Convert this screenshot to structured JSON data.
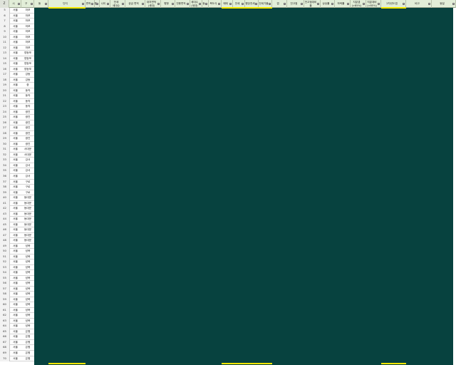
{
  "columns": [
    {
      "label": "Z",
      "filter": false
    },
    {
      "label": "시",
      "filter": true
    },
    {
      "label": "구",
      "filter": true
    },
    {
      "label": "동",
      "filter": true
    },
    {
      "label": "단지",
      "filter": true
    },
    {
      "label": "면적",
      "filter": true
    },
    {
      "label": "평",
      "filter": true
    },
    {
      "label": "나이",
      "filter": true
    },
    {
      "label": "전세\n세대수",
      "filter": true
    },
    {
      "label": "공급 면적",
      "filter": true
    },
    {
      "label": "대지면적\n(세대)",
      "filter": true
    },
    {
      "label": "평형",
      "filter": true
    },
    {
      "label": "전용면적",
      "filter": true
    },
    {
      "label": "세대수\n(세대)",
      "filter": true
    },
    {
      "label": "동",
      "filter": true
    },
    {
      "label": "복도식",
      "filter": true
    },
    {
      "label": "매매",
      "filter": true
    },
    {
      "label": "전세",
      "filter": true
    },
    {
      "label": "평당전세",
      "filter": true
    },
    {
      "label": "전세가율",
      "filter": true
    },
    {
      "label": "갭",
      "filter": true
    },
    {
      "label": "전고점",
      "filter": true
    },
    {
      "label": "전고점대비율",
      "filter": true
    },
    {
      "label": "상승률",
      "filter": true
    },
    {
      "label": "하락률",
      "filter": true
    },
    {
      "label": "지분갭\n(>85%)",
      "filter": true
    },
    {
      "label": "지분대비\n(>85%)",
      "filter": true
    },
    {
      "label": "2차년도갭",
      "filter": true
    },
    {
      "label": "비고",
      "filter": true
    },
    {
      "label": "동일",
      "filter": true
    }
  ],
  "rows": [
    {
      "n": "5",
      "city": "서울",
      "district": "마포"
    },
    {
      "n": "6",
      "city": "서울",
      "district": "마포"
    },
    {
      "n": "7",
      "city": "서울",
      "district": "마포"
    },
    {
      "n": "8",
      "city": "서울",
      "district": "마포"
    },
    {
      "n": "9",
      "city": "서울",
      "district": "마포"
    },
    {
      "n": "10",
      "city": "서울",
      "district": "마포"
    },
    {
      "n": "11",
      "city": "서울",
      "district": "마포"
    },
    {
      "n": "12",
      "city": "서울",
      "district": "마포"
    },
    {
      "n": "13",
      "city": "서울",
      "district": "영등포"
    },
    {
      "n": "14",
      "city": "서울",
      "district": "영등포"
    },
    {
      "n": "15",
      "city": "서울",
      "district": "영등포"
    },
    {
      "n": "16",
      "city": "서울",
      "district": "영등포"
    },
    {
      "n": "17",
      "city": "서울",
      "district": "강동"
    },
    {
      "n": "18",
      "city": "서울",
      "district": "강동"
    },
    {
      "n": "19",
      "city": "서울",
      "district": "중"
    },
    {
      "n": "20",
      "city": "서울",
      "district": "동작"
    },
    {
      "n": "21",
      "city": "서울",
      "district": "동작"
    },
    {
      "n": "22",
      "city": "서울",
      "district": "동작"
    },
    {
      "n": "23",
      "city": "서울",
      "district": "동작"
    },
    {
      "n": "24",
      "city": "서울",
      "district": "광진"
    },
    {
      "n": "25",
      "city": "서울",
      "district": "광진"
    },
    {
      "n": "26",
      "city": "서울",
      "district": "광진"
    },
    {
      "n": "27",
      "city": "서울",
      "district": "광진"
    },
    {
      "n": "28",
      "city": "서울",
      "district": "광진"
    },
    {
      "n": "29",
      "city": "서울",
      "district": "광진"
    },
    {
      "n": "30",
      "city": "서울",
      "district": "광진"
    },
    {
      "n": "31",
      "city": "서울",
      "district": "서대문"
    },
    {
      "n": "32",
      "city": "서울",
      "district": "서대문"
    },
    {
      "n": "33",
      "city": "서울",
      "district": "강서"
    },
    {
      "n": "34",
      "city": "서울",
      "district": "강서"
    },
    {
      "n": "35",
      "city": "서울",
      "district": "강서"
    },
    {
      "n": "36",
      "city": "서울",
      "district": "강서"
    },
    {
      "n": "37",
      "city": "서울",
      "district": "구로"
    },
    {
      "n": "38",
      "city": "서울",
      "district": "구로"
    },
    {
      "n": "39",
      "city": "서울",
      "district": "구로"
    },
    {
      "n": "40",
      "city": "서울",
      "district": "동대문"
    },
    {
      "n": "41",
      "city": "서울",
      "district": "동대문"
    },
    {
      "n": "42",
      "city": "서울",
      "district": "동대문"
    },
    {
      "n": "43",
      "city": "서울",
      "district": "동대문"
    },
    {
      "n": "44",
      "city": "서울",
      "district": "동대문"
    },
    {
      "n": "45",
      "city": "서울",
      "district": "동대문"
    },
    {
      "n": "46",
      "city": "서울",
      "district": "동대문"
    },
    {
      "n": "47",
      "city": "서울",
      "district": "동대문"
    },
    {
      "n": "48",
      "city": "서울",
      "district": "동대문"
    },
    {
      "n": "49",
      "city": "서울",
      "district": "성북"
    },
    {
      "n": "50",
      "city": "서울",
      "district": "성북"
    },
    {
      "n": "51",
      "city": "서울",
      "district": "성북"
    },
    {
      "n": "52",
      "city": "서울",
      "district": "성북"
    },
    {
      "n": "53",
      "city": "서울",
      "district": "성북"
    },
    {
      "n": "54",
      "city": "서울",
      "district": "성북"
    },
    {
      "n": "55",
      "city": "서울",
      "district": "성북"
    },
    {
      "n": "56",
      "city": "서울",
      "district": "성북"
    },
    {
      "n": "57",
      "city": "서울",
      "district": "성북"
    },
    {
      "n": "58",
      "city": "서울",
      "district": "성북"
    },
    {
      "n": "59",
      "city": "서울",
      "district": "성북"
    },
    {
      "n": "60",
      "city": "서울",
      "district": "성북"
    },
    {
      "n": "61",
      "city": "서울",
      "district": "성북"
    },
    {
      "n": "62",
      "city": "서울",
      "district": "성북"
    },
    {
      "n": "63",
      "city": "서울",
      "district": "성북"
    },
    {
      "n": "64",
      "city": "서울",
      "district": "성북"
    },
    {
      "n": "65",
      "city": "서울",
      "district": "은평"
    },
    {
      "n": "66",
      "city": "서울",
      "district": "은평"
    },
    {
      "n": "67",
      "city": "서울",
      "district": "은평"
    },
    {
      "n": "68",
      "city": "서울",
      "district": "은평"
    },
    {
      "n": "69",
      "city": "서울",
      "district": "은평"
    },
    {
      "n": "70",
      "city": "서울",
      "district": "은평"
    }
  ],
  "colors": {
    "header_bg": "#e2eed8",
    "body_fill": "#07423f",
    "filter_highlight": "#f2e600"
  }
}
